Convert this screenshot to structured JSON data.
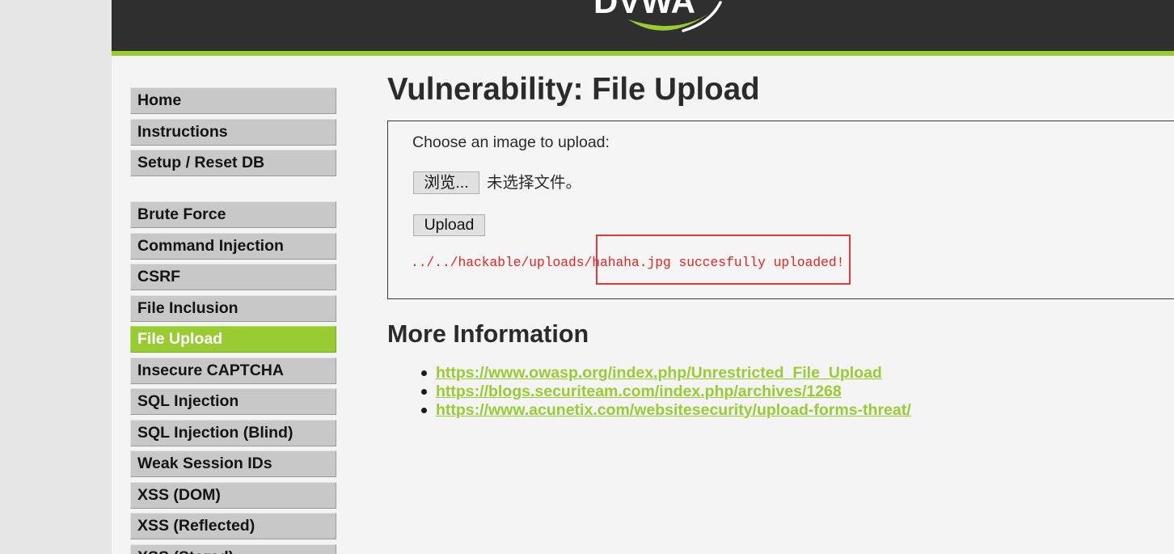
{
  "header": {
    "logo_text": "DVWA"
  },
  "menu": {
    "primary": [
      {
        "label": "Home"
      },
      {
        "label": "Instructions"
      },
      {
        "label": "Setup / Reset DB"
      }
    ],
    "vulnerabilities": [
      {
        "label": "Brute Force"
      },
      {
        "label": "Command Injection"
      },
      {
        "label": "CSRF"
      },
      {
        "label": "File Inclusion"
      },
      {
        "label": "File Upload",
        "selected": true
      },
      {
        "label": "Insecure CAPTCHA"
      },
      {
        "label": "SQL Injection"
      },
      {
        "label": "SQL Injection (Blind)"
      },
      {
        "label": "Weak Session IDs"
      },
      {
        "label": "XSS (DOM)"
      },
      {
        "label": "XSS (Reflected)"
      },
      {
        "label": "XSS (Stored)"
      }
    ]
  },
  "page": {
    "title": "Vulnerability: File Upload",
    "upload_form": {
      "prompt": "Choose an image to upload:",
      "browse_button": "浏览...",
      "file_status": "未选择文件。",
      "upload_button": "Upload",
      "result_message": "../../hackable/uploads/hahaha.jpg succesfully uploaded!"
    },
    "more_info": {
      "heading": "More Information",
      "links": [
        "https://www.owasp.org/index.php/Unrestricted_File_Upload",
        "https://blogs.securiteam.com/index.php/archives/1268",
        "https://www.acunetix.com/websitesecurity/upload-forms-threat/"
      ]
    }
  },
  "colors": {
    "accent": "#99cc33",
    "header_bg": "#2f2f2f",
    "message": "#e8221f",
    "highlight": "#e23a3a"
  }
}
